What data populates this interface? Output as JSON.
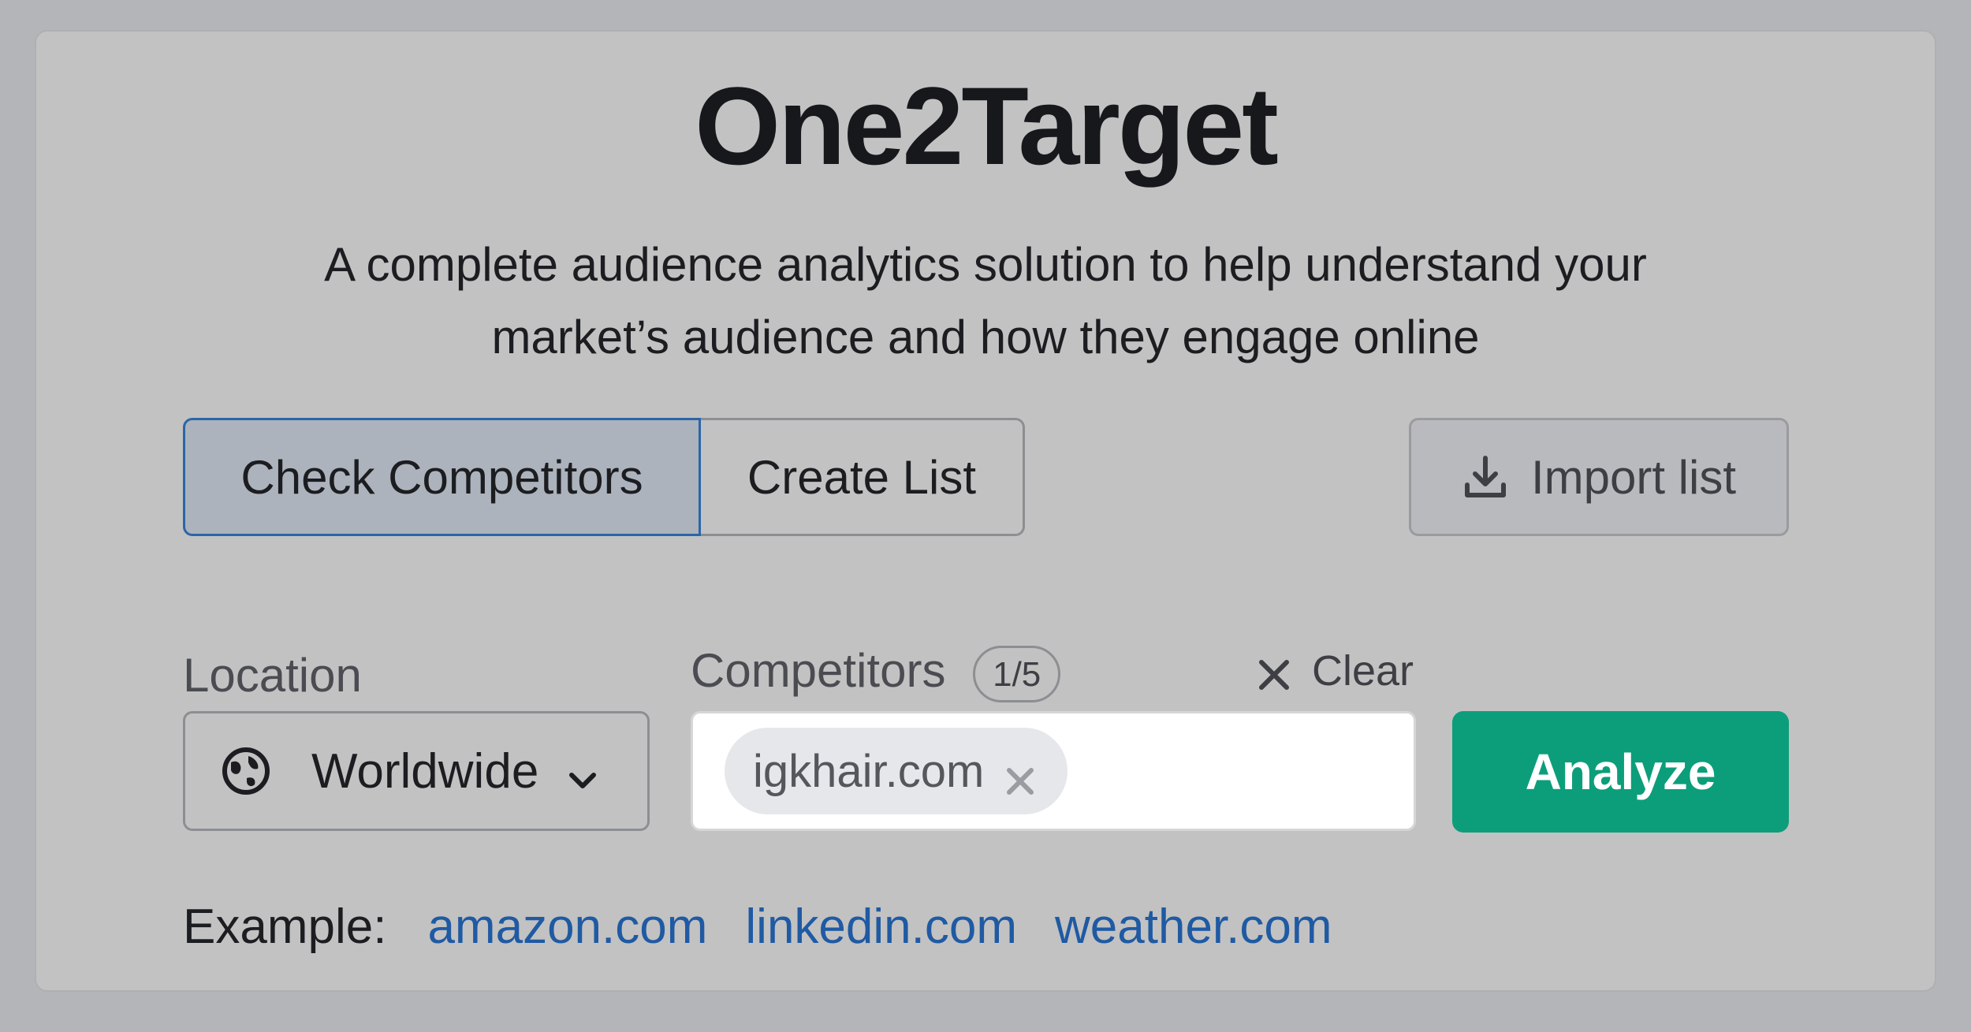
{
  "header": {
    "title": "One2Target",
    "subtitle_line1": "A complete audience analytics solution to help understand your",
    "subtitle_line2": "market’s audience and how they engage online"
  },
  "mode_tabs": [
    {
      "label": "Check Competitors",
      "active": true
    },
    {
      "label": "Create List",
      "active": false
    }
  ],
  "import": {
    "label": "Import list",
    "icon": "download-icon"
  },
  "location": {
    "label": "Location",
    "value": "Worldwide",
    "icon": "globe-icon"
  },
  "competitors": {
    "label": "Competitors",
    "count_badge": "1/5",
    "clear_label": "Clear",
    "chips": [
      {
        "value": "igkhair.com"
      }
    ]
  },
  "analyze": {
    "label": "Analyze"
  },
  "examples": {
    "label": "Example:",
    "links": [
      "amazon.com",
      "linkedin.com",
      "weather.com"
    ]
  },
  "colors": {
    "accent": "#0c9e7a",
    "link": "#1f5aa3",
    "active_tab_border": "#2a66a8"
  }
}
